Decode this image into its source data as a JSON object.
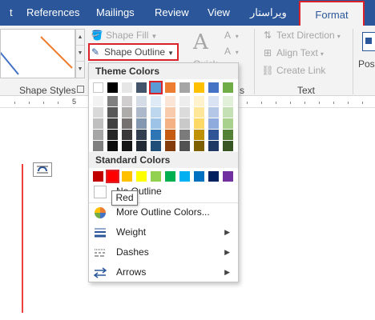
{
  "ribbon": {
    "tabs": [
      {
        "label": "t"
      },
      {
        "label": "References"
      },
      {
        "label": "Mailings"
      },
      {
        "label": "Review"
      },
      {
        "label": "View"
      },
      {
        "label": "ویراستار"
      },
      {
        "label": "Format"
      }
    ],
    "active_tab": "Format",
    "group_labels": [
      "Shape Styles",
      "s",
      "Text"
    ],
    "commands": {
      "shape_fill": "Shape Fill",
      "shape_outline": "Shape Outline",
      "quick_styles": "Quick",
      "text_direction": "Text Direction",
      "align_text": "Align Text",
      "create_link": "Create Link",
      "position": "Posi"
    },
    "ruler_number": "5"
  },
  "dropdown": {
    "theme_colors_heading": "Theme Colors",
    "theme_colors": [
      "#ffffff",
      "#000000",
      "#e7e6e6",
      "#44546a",
      "#5b9bd5",
      "#ed7d31",
      "#a5a5a5",
      "#ffc000",
      "#4472c4",
      "#70ad47"
    ],
    "tint_rows": [
      [
        "#f2f2f2",
        "#808080",
        "#d0cece",
        "#d6dce5",
        "#deebf7",
        "#fbe5d6",
        "#ededed",
        "#fff2cc",
        "#dae3f3",
        "#e2f0d9"
      ],
      [
        "#d9d9d9",
        "#595959",
        "#aeabab",
        "#adb9ca",
        "#bdd7ee",
        "#f8cbad",
        "#dbdbdb",
        "#ffe699",
        "#b4c7e7",
        "#c5e0b4"
      ],
      [
        "#bfbfbf",
        "#404040",
        "#757171",
        "#8497b0",
        "#9dc3e6",
        "#f4b183",
        "#c9c9c9",
        "#ffd966",
        "#8faadc",
        "#a9d18e"
      ],
      [
        "#a6a6a6",
        "#262626",
        "#3a3838",
        "#333f50",
        "#2e75b6",
        "#c55a11",
        "#7b7b7b",
        "#bf9000",
        "#2f5597",
        "#538135"
      ],
      [
        "#808080",
        "#0d0d0d",
        "#171616",
        "#222a35",
        "#1f4e79",
        "#843c0c",
        "#525252",
        "#7f6000",
        "#203864",
        "#375623"
      ]
    ],
    "standard_colors_heading": "Standard Colors",
    "standard_colors": [
      "#c00000",
      "#ff0000",
      "#ffc000",
      "#ffff00",
      "#92d050",
      "#00b050",
      "#00b0f0",
      "#0070c0",
      "#002060",
      "#7030a0"
    ],
    "selected_standard_color": "Red",
    "no_outline_label": "No Outline",
    "tooltip": "Red",
    "menu_items": [
      {
        "label": "More Outline Colors..."
      },
      {
        "label": "Weight"
      },
      {
        "label": "Dashes"
      },
      {
        "label": "Arrows"
      }
    ]
  }
}
